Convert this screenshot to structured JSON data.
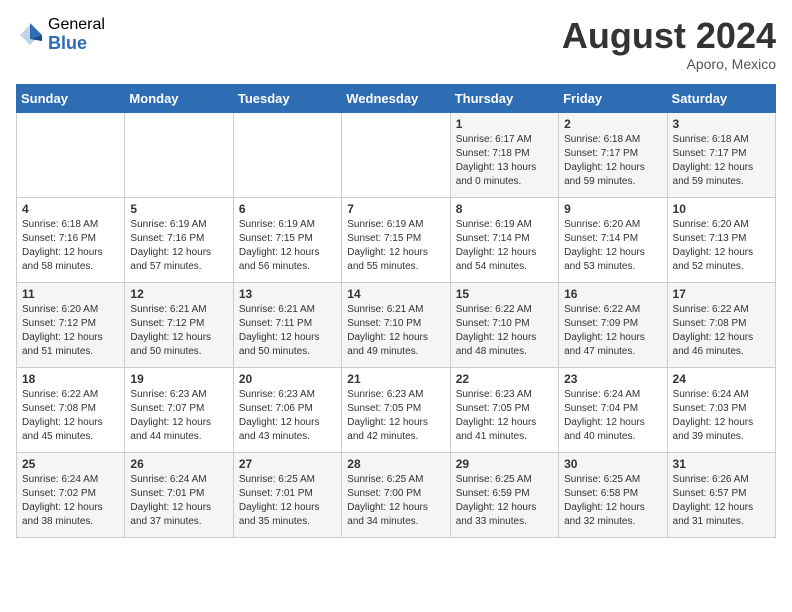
{
  "logo": {
    "general": "General",
    "blue": "Blue"
  },
  "title": {
    "month_year": "August 2024",
    "location": "Aporo, Mexico"
  },
  "days_of_week": [
    "Sunday",
    "Monday",
    "Tuesday",
    "Wednesday",
    "Thursday",
    "Friday",
    "Saturday"
  ],
  "weeks": [
    [
      {
        "day": "",
        "sunrise": "",
        "sunset": "",
        "daylight": ""
      },
      {
        "day": "",
        "sunrise": "",
        "sunset": "",
        "daylight": ""
      },
      {
        "day": "",
        "sunrise": "",
        "sunset": "",
        "daylight": ""
      },
      {
        "day": "",
        "sunrise": "",
        "sunset": "",
        "daylight": ""
      },
      {
        "day": "1",
        "sunrise": "Sunrise: 6:17 AM",
        "sunset": "Sunset: 7:18 PM",
        "daylight": "Daylight: 13 hours and 0 minutes."
      },
      {
        "day": "2",
        "sunrise": "Sunrise: 6:18 AM",
        "sunset": "Sunset: 7:17 PM",
        "daylight": "Daylight: 12 hours and 59 minutes."
      },
      {
        "day": "3",
        "sunrise": "Sunrise: 6:18 AM",
        "sunset": "Sunset: 7:17 PM",
        "daylight": "Daylight: 12 hours and 59 minutes."
      }
    ],
    [
      {
        "day": "4",
        "sunrise": "Sunrise: 6:18 AM",
        "sunset": "Sunset: 7:16 PM",
        "daylight": "Daylight: 12 hours and 58 minutes."
      },
      {
        "day": "5",
        "sunrise": "Sunrise: 6:19 AM",
        "sunset": "Sunset: 7:16 PM",
        "daylight": "Daylight: 12 hours and 57 minutes."
      },
      {
        "day": "6",
        "sunrise": "Sunrise: 6:19 AM",
        "sunset": "Sunset: 7:15 PM",
        "daylight": "Daylight: 12 hours and 56 minutes."
      },
      {
        "day": "7",
        "sunrise": "Sunrise: 6:19 AM",
        "sunset": "Sunset: 7:15 PM",
        "daylight": "Daylight: 12 hours and 55 minutes."
      },
      {
        "day": "8",
        "sunrise": "Sunrise: 6:19 AM",
        "sunset": "Sunset: 7:14 PM",
        "daylight": "Daylight: 12 hours and 54 minutes."
      },
      {
        "day": "9",
        "sunrise": "Sunrise: 6:20 AM",
        "sunset": "Sunset: 7:14 PM",
        "daylight": "Daylight: 12 hours and 53 minutes."
      },
      {
        "day": "10",
        "sunrise": "Sunrise: 6:20 AM",
        "sunset": "Sunset: 7:13 PM",
        "daylight": "Daylight: 12 hours and 52 minutes."
      }
    ],
    [
      {
        "day": "11",
        "sunrise": "Sunrise: 6:20 AM",
        "sunset": "Sunset: 7:12 PM",
        "daylight": "Daylight: 12 hours and 51 minutes."
      },
      {
        "day": "12",
        "sunrise": "Sunrise: 6:21 AM",
        "sunset": "Sunset: 7:12 PM",
        "daylight": "Daylight: 12 hours and 50 minutes."
      },
      {
        "day": "13",
        "sunrise": "Sunrise: 6:21 AM",
        "sunset": "Sunset: 7:11 PM",
        "daylight": "Daylight: 12 hours and 50 minutes."
      },
      {
        "day": "14",
        "sunrise": "Sunrise: 6:21 AM",
        "sunset": "Sunset: 7:10 PM",
        "daylight": "Daylight: 12 hours and 49 minutes."
      },
      {
        "day": "15",
        "sunrise": "Sunrise: 6:22 AM",
        "sunset": "Sunset: 7:10 PM",
        "daylight": "Daylight: 12 hours and 48 minutes."
      },
      {
        "day": "16",
        "sunrise": "Sunrise: 6:22 AM",
        "sunset": "Sunset: 7:09 PM",
        "daylight": "Daylight: 12 hours and 47 minutes."
      },
      {
        "day": "17",
        "sunrise": "Sunrise: 6:22 AM",
        "sunset": "Sunset: 7:08 PM",
        "daylight": "Daylight: 12 hours and 46 minutes."
      }
    ],
    [
      {
        "day": "18",
        "sunrise": "Sunrise: 6:22 AM",
        "sunset": "Sunset: 7:08 PM",
        "daylight": "Daylight: 12 hours and 45 minutes."
      },
      {
        "day": "19",
        "sunrise": "Sunrise: 6:23 AM",
        "sunset": "Sunset: 7:07 PM",
        "daylight": "Daylight: 12 hours and 44 minutes."
      },
      {
        "day": "20",
        "sunrise": "Sunrise: 6:23 AM",
        "sunset": "Sunset: 7:06 PM",
        "daylight": "Daylight: 12 hours and 43 minutes."
      },
      {
        "day": "21",
        "sunrise": "Sunrise: 6:23 AM",
        "sunset": "Sunset: 7:05 PM",
        "daylight": "Daylight: 12 hours and 42 minutes."
      },
      {
        "day": "22",
        "sunrise": "Sunrise: 6:23 AM",
        "sunset": "Sunset: 7:05 PM",
        "daylight": "Daylight: 12 hours and 41 minutes."
      },
      {
        "day": "23",
        "sunrise": "Sunrise: 6:24 AM",
        "sunset": "Sunset: 7:04 PM",
        "daylight": "Daylight: 12 hours and 40 minutes."
      },
      {
        "day": "24",
        "sunrise": "Sunrise: 6:24 AM",
        "sunset": "Sunset: 7:03 PM",
        "daylight": "Daylight: 12 hours and 39 minutes."
      }
    ],
    [
      {
        "day": "25",
        "sunrise": "Sunrise: 6:24 AM",
        "sunset": "Sunset: 7:02 PM",
        "daylight": "Daylight: 12 hours and 38 minutes."
      },
      {
        "day": "26",
        "sunrise": "Sunrise: 6:24 AM",
        "sunset": "Sunset: 7:01 PM",
        "daylight": "Daylight: 12 hours and 37 minutes."
      },
      {
        "day": "27",
        "sunrise": "Sunrise: 6:25 AM",
        "sunset": "Sunset: 7:01 PM",
        "daylight": "Daylight: 12 hours and 35 minutes."
      },
      {
        "day": "28",
        "sunrise": "Sunrise: 6:25 AM",
        "sunset": "Sunset: 7:00 PM",
        "daylight": "Daylight: 12 hours and 34 minutes."
      },
      {
        "day": "29",
        "sunrise": "Sunrise: 6:25 AM",
        "sunset": "Sunset: 6:59 PM",
        "daylight": "Daylight: 12 hours and 33 minutes."
      },
      {
        "day": "30",
        "sunrise": "Sunrise: 6:25 AM",
        "sunset": "Sunset: 6:58 PM",
        "daylight": "Daylight: 12 hours and 32 minutes."
      },
      {
        "day": "31",
        "sunrise": "Sunrise: 6:26 AM",
        "sunset": "Sunset: 6:57 PM",
        "daylight": "Daylight: 12 hours and 31 minutes."
      }
    ]
  ]
}
